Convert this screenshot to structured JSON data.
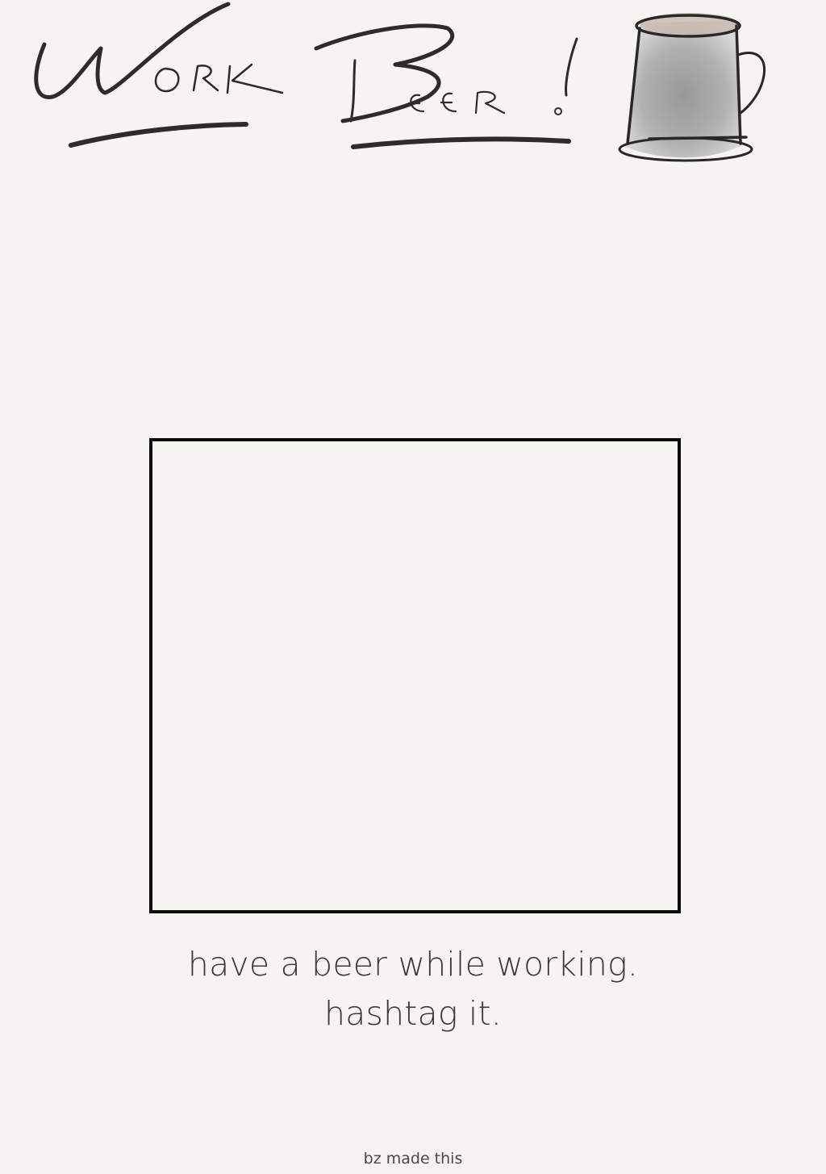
{
  "header": {
    "logo_text": "Work Beer!",
    "mug_icon": "beer-mug-icon"
  },
  "photo": {
    "state": "empty"
  },
  "tagline": {
    "line1": "have a beer while working.",
    "line2": "hashtag it."
  },
  "footer": {
    "credit": "bz made this"
  },
  "colors": {
    "background": "#f5f4f0",
    "ink": "#2e2c29",
    "frame": "#0d0d0d",
    "text": "#3c3a38"
  }
}
